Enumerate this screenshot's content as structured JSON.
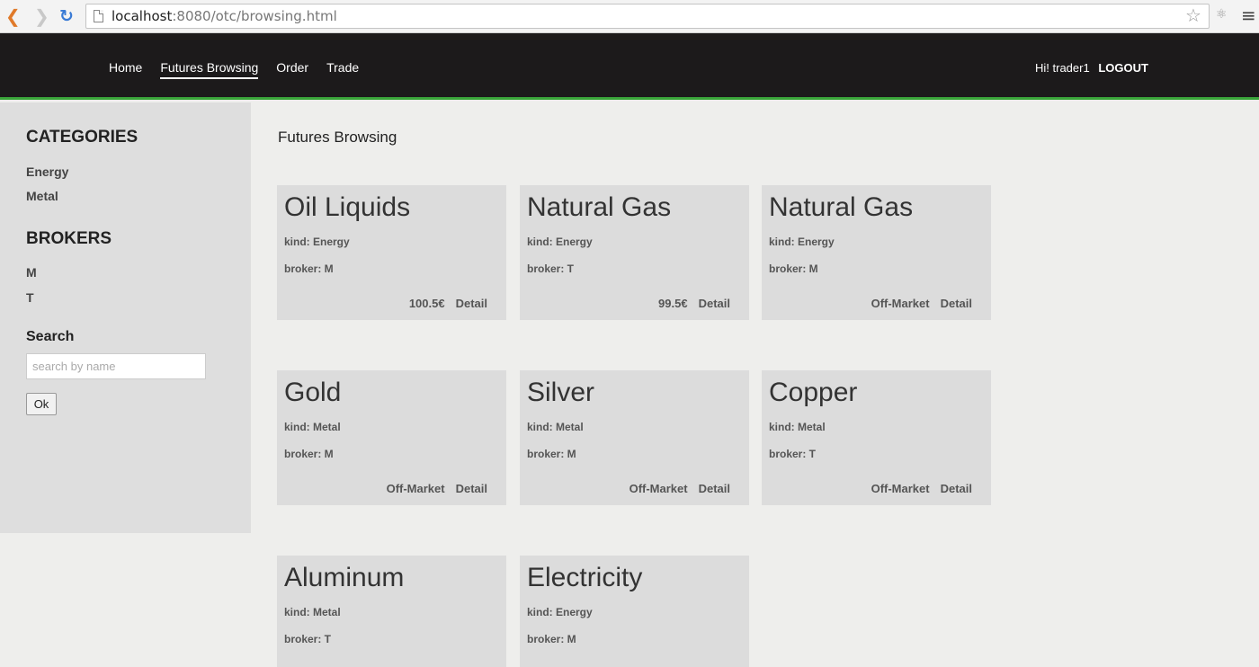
{
  "browser": {
    "url_host": "localhost",
    "url_rest": ":8080/otc/browsing.html"
  },
  "header": {
    "nav": [
      "Home",
      "Futures Browsing",
      "Order",
      "Trade"
    ],
    "greeting": "Hi! trader1",
    "logout": "LOGOUT",
    "accent_color": "#3aa63a"
  },
  "sidebar": {
    "categories_title": "CATEGORIES",
    "categories": [
      "Energy",
      "Metal"
    ],
    "brokers_title": "BROKERS",
    "brokers": [
      "M",
      "T"
    ],
    "search_title": "Search",
    "search_placeholder": "search by name",
    "ok_label": "Ok"
  },
  "main": {
    "title": "Futures Browsing",
    "cards": [
      {
        "name": "Oil Liquids",
        "kind": "kind: Energy",
        "broker": "broker: M",
        "price": "100.5€",
        "detail": "Detail"
      },
      {
        "name": "Natural Gas",
        "kind": "kind: Energy",
        "broker": "broker: T",
        "price": "99.5€",
        "detail": "Detail"
      },
      {
        "name": "Natural Gas",
        "kind": "kind: Energy",
        "broker": "broker: M",
        "price": "Off-Market",
        "detail": "Detail"
      },
      {
        "name": "Gold",
        "kind": "kind: Metal",
        "broker": "broker: M",
        "price": "Off-Market",
        "detail": "Detail"
      },
      {
        "name": "Silver",
        "kind": "kind: Metal",
        "broker": "broker: M",
        "price": "Off-Market",
        "detail": "Detail"
      },
      {
        "name": "Copper",
        "kind": "kind: Metal",
        "broker": "broker: T",
        "price": "Off-Market",
        "detail": "Detail"
      },
      {
        "name": "Aluminum",
        "kind": "kind: Metal",
        "broker": "broker: T",
        "price": "",
        "detail": ""
      },
      {
        "name": "Electricity",
        "kind": "kind: Energy",
        "broker": "broker: M",
        "price": "",
        "detail": ""
      }
    ]
  }
}
